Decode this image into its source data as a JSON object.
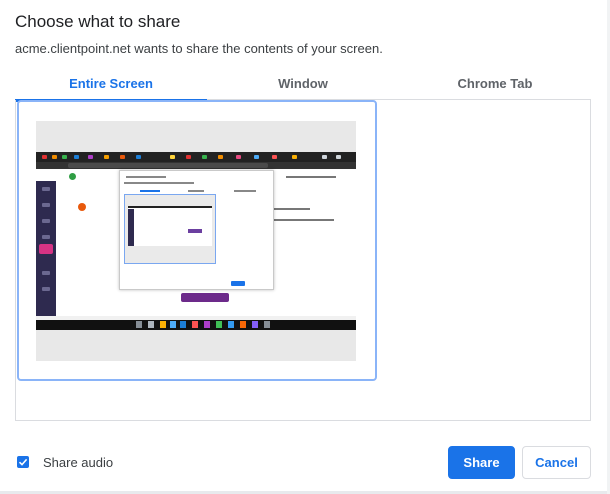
{
  "dialog": {
    "title": "Choose what to share",
    "subtitle": "acme.clientpoint.net wants to share the contents of your screen."
  },
  "tabs": [
    {
      "label": "Entire Screen",
      "active": true
    },
    {
      "label": "Window",
      "active": false
    },
    {
      "label": "Chrome Tab",
      "active": false
    }
  ],
  "sources": [
    {
      "type": "entire-screen",
      "selected": true
    }
  ],
  "audio": {
    "label": "Share audio",
    "checked": true
  },
  "buttons": {
    "share": "Share",
    "cancel": "Cancel"
  },
  "colors": {
    "accent": "#1a73e8",
    "selected_border": "#8ab4f8",
    "divider": "#dadce0"
  }
}
